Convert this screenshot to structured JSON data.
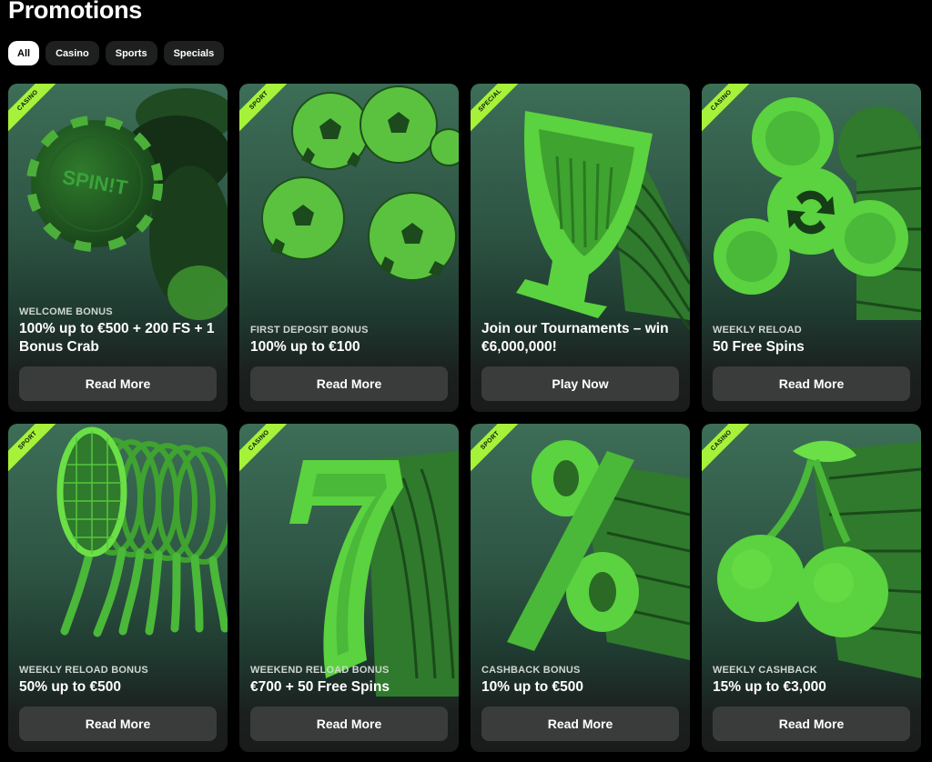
{
  "page": {
    "title": "Promotions"
  },
  "filters": [
    {
      "label": "All",
      "active": true
    },
    {
      "label": "Casino",
      "active": false
    },
    {
      "label": "Sports",
      "active": false
    },
    {
      "label": "Specials",
      "active": false
    }
  ],
  "colors": {
    "accent": "#a6f23a",
    "card_bg_top": "#3d6e57",
    "card_bg_bottom": "#191b1a",
    "button_bg": "#3a3c3b",
    "page_bg": "#000000"
  },
  "cards": [
    {
      "ribbon": "CASINO",
      "art": "casino-chips-icon",
      "kicker": "WELCOME BONUS",
      "title": "100% up to €500 + 200 FS + 1 Bonus Crab",
      "button": "Read More",
      "chip_text": "SPIN!T"
    },
    {
      "ribbon": "SPORT",
      "art": "soccer-balls-icon",
      "kicker": "FIRST DEPOSIT BONUS",
      "title": "100% up to €100",
      "button": "Read More"
    },
    {
      "ribbon": "SPECIAL",
      "art": "trophy-icon",
      "kicker": "",
      "title": "Join our Tournaments – win €6,000,000!",
      "button": "Play Now"
    },
    {
      "ribbon": "CASINO",
      "art": "fidget-spinner-icon",
      "kicker": "WEEKLY RELOAD",
      "title": "50 Free Spins",
      "button": "Read More"
    },
    {
      "ribbon": "SPORT",
      "art": "tennis-racket-icon",
      "kicker": "WEEKLY RELOAD BONUS",
      "title": "50% up to €500",
      "button": "Read More"
    },
    {
      "ribbon": "CASINO",
      "art": "lucky-seven-icon",
      "kicker": "WEEKEND RELOAD BONUS",
      "title": "€700 + 50 Free Spins",
      "button": "Read More"
    },
    {
      "ribbon": "SPORT",
      "art": "percent-sign-icon",
      "kicker": "CASHBACK BONUS",
      "title": "10% up to €500",
      "button": "Read More"
    },
    {
      "ribbon": "CASINO",
      "art": "cherries-icon",
      "kicker": "WEEKLY CASHBACK",
      "title": "15% up to €3,000",
      "button": "Read More"
    }
  ]
}
